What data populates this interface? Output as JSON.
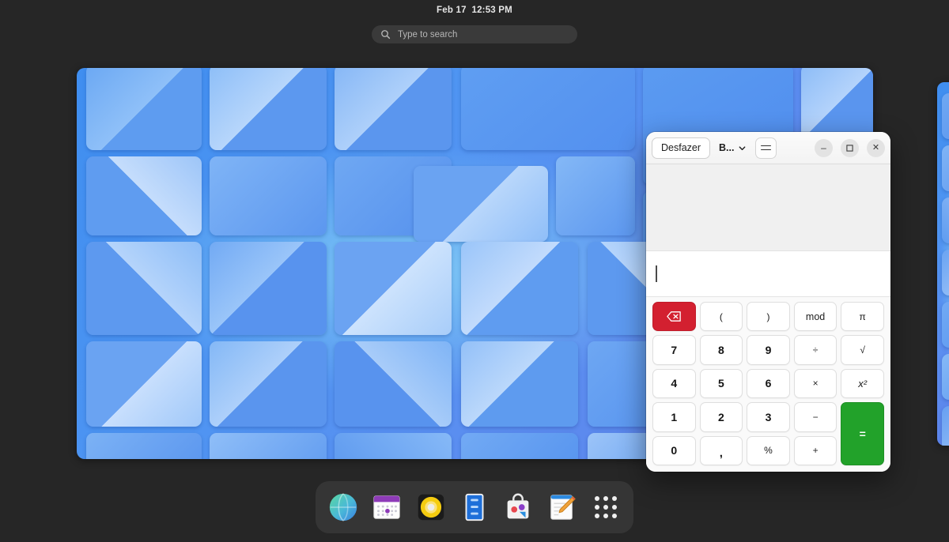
{
  "topbar": {
    "clock": "Feb 17  12:53 PM"
  },
  "search": {
    "placeholder": "Type to search",
    "icon": "search-icon"
  },
  "calculator": {
    "headerbar": {
      "undo_label": "Desfazer",
      "mode_label": "B...",
      "mode_chevron_icon": "chevron-down-icon",
      "menu_icon": "hamburger-menu-icon",
      "minimize_label": "–",
      "maximize_label": "☐",
      "close_label": "✕"
    },
    "display": {
      "history_text": "",
      "entry_value": "",
      "caret_visible": true
    },
    "keypad": {
      "rows": [
        [
          {
            "label": "⌫",
            "name": "backspace",
            "style": "del"
          },
          {
            "label": "(",
            "name": "open-paren",
            "style": "small"
          },
          {
            "label": ")",
            "name": "close-paren",
            "style": "small"
          },
          {
            "label": "mod",
            "name": "modulo",
            "style": "word"
          },
          {
            "label": "π",
            "name": "pi",
            "style": "small"
          }
        ],
        [
          {
            "label": "7",
            "name": "digit-7",
            "style": "digit"
          },
          {
            "label": "8",
            "name": "digit-8",
            "style": "digit"
          },
          {
            "label": "9",
            "name": "digit-9",
            "style": "digit"
          },
          {
            "label": "÷",
            "name": "divide",
            "style": "op"
          },
          {
            "label": "√",
            "name": "square-root",
            "style": "small"
          }
        ],
        [
          {
            "label": "4",
            "name": "digit-4",
            "style": "digit"
          },
          {
            "label": "5",
            "name": "digit-5",
            "style": "digit"
          },
          {
            "label": "6",
            "name": "digit-6",
            "style": "digit"
          },
          {
            "label": "×",
            "name": "multiply",
            "style": "op"
          },
          {
            "label": "x²",
            "name": "square",
            "style": "sq"
          }
        ],
        [
          {
            "label": "1",
            "name": "digit-1",
            "style": "digit"
          },
          {
            "label": "2",
            "name": "digit-2",
            "style": "digit"
          },
          {
            "label": "3",
            "name": "digit-3",
            "style": "digit"
          },
          {
            "label": "−",
            "name": "subtract",
            "style": "op"
          },
          {
            "label": "=",
            "name": "equals",
            "style": "eq"
          }
        ],
        [
          {
            "label": "0",
            "name": "digit-0",
            "style": "digit"
          },
          {
            "label": ",",
            "name": "decimal-separator",
            "style": "comma"
          },
          {
            "label": "%",
            "name": "percent",
            "style": "small"
          },
          {
            "label": "+",
            "name": "add",
            "style": "op"
          }
        ]
      ]
    },
    "colors": {
      "delete_key": "#d32030",
      "equals_key": "#22a22a"
    }
  },
  "dock": {
    "items": [
      {
        "name": "dock-item-web-browser",
        "icon": "globe-icon"
      },
      {
        "name": "dock-item-calendar",
        "icon": "calendar-icon"
      },
      {
        "name": "dock-item-music",
        "icon": "speaker-icon"
      },
      {
        "name": "dock-item-files",
        "icon": "file-cabinet-icon"
      },
      {
        "name": "dock-item-software",
        "icon": "shopping-bag-icon"
      },
      {
        "name": "dock-item-text-editor",
        "icon": "notepad-pencil-icon"
      },
      {
        "name": "dock-item-show-apps",
        "icon": "grid-dots-icon"
      }
    ]
  },
  "desktop": {
    "workspace_count_visible": 2
  }
}
